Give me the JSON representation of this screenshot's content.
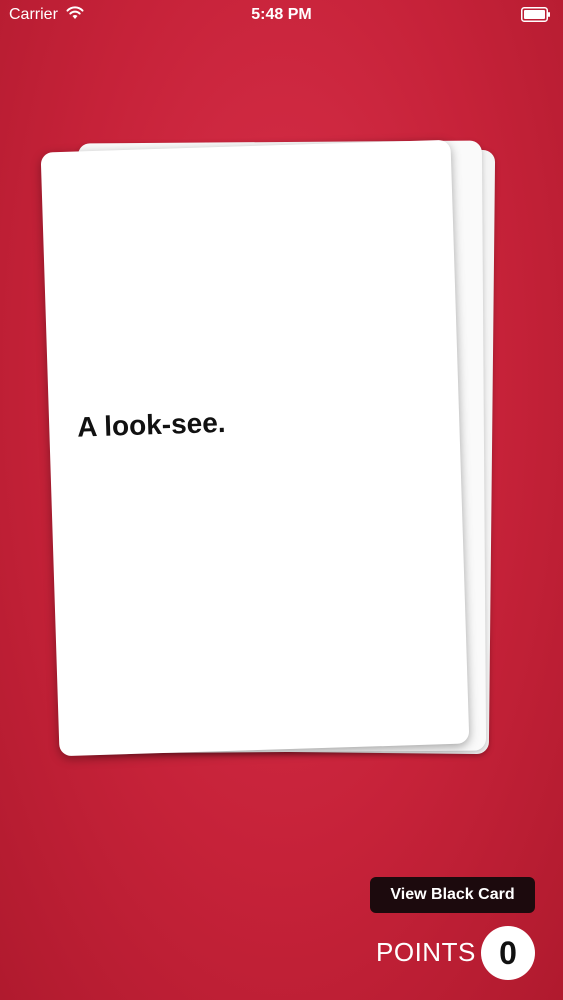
{
  "status_bar": {
    "carrier": "Carrier",
    "time": "5:48 PM",
    "wifi_icon": "wifi-icon",
    "battery_icon": "battery-icon"
  },
  "card": {
    "text": "A look-see."
  },
  "actions": {
    "view_black_card_label": "View Black Card"
  },
  "score": {
    "label": "POINTS",
    "value": "0"
  },
  "colors": {
    "background": "#c8243b",
    "card": "#ffffff",
    "button": "#1c0a0d"
  }
}
